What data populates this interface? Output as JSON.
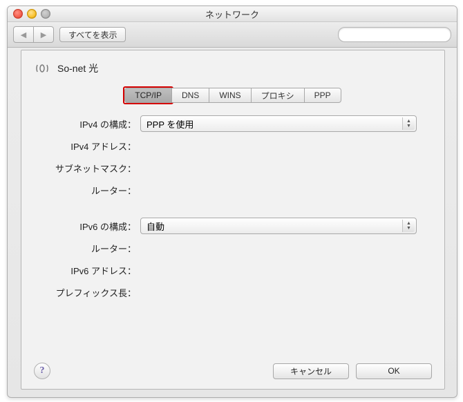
{
  "window": {
    "title": "ネットワーク"
  },
  "toolbar": {
    "back_label": "◀",
    "fwd_label": "▶",
    "show_all": "すべてを表示",
    "search_placeholder": ""
  },
  "connection": {
    "name": "So-net 光"
  },
  "tabs": [
    {
      "label": "TCP/IP",
      "active": true
    },
    {
      "label": "DNS",
      "active": false
    },
    {
      "label": "WINS",
      "active": false
    },
    {
      "label": "プロキシ",
      "active": false
    },
    {
      "label": "PPP",
      "active": false
    }
  ],
  "form": {
    "ipv4_config_label": "IPv4 の構成：",
    "ipv4_config_value": "PPP を使用",
    "ipv4_address_label": "IPv4 アドレス：",
    "ipv4_address_value": "",
    "subnet_label": "サブネットマスク：",
    "subnet_value": "",
    "router4_label": "ルーター：",
    "router4_value": "",
    "ipv6_config_label": "IPv6 の構成：",
    "ipv6_config_value": "自動",
    "router6_label": "ルーター：",
    "router6_value": "",
    "ipv6_address_label": "IPv6 アドレス：",
    "ipv6_address_value": "",
    "prefix_label": "プレフィックス長：",
    "prefix_value": ""
  },
  "buttons": {
    "help": "?",
    "cancel": "キャンセル",
    "ok": "OK"
  }
}
